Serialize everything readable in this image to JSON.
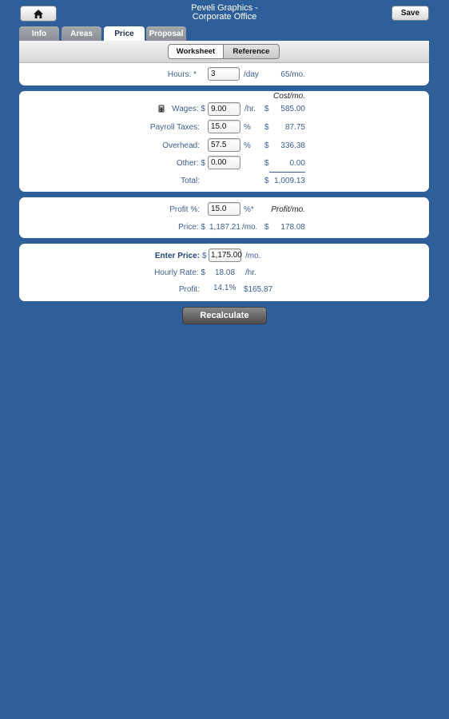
{
  "header": {
    "title_line1": "Peveli Graphics -",
    "title_line2": "Corporate Office",
    "save_label": "Save"
  },
  "tabs": [
    {
      "label": "Info"
    },
    {
      "label": "Areas"
    },
    {
      "label": "Price",
      "active": true
    },
    {
      "label": "Proposal"
    }
  ],
  "segments": {
    "worksheet": "Worksheet",
    "reference": "Reference"
  },
  "hours": {
    "label": "Hours: *",
    "value": "3",
    "unit": "/day",
    "monthly": "65/mo."
  },
  "costs": {
    "header": "Cost/mo.",
    "wages": {
      "label": "Wages: $",
      "value": "9.00",
      "unit": "/hr.",
      "currency": "$",
      "monthly": "585.00"
    },
    "payroll": {
      "label": "Payroll Taxes:",
      "value": "15.0",
      "unit": "%",
      "currency": "$",
      "monthly": "87.75"
    },
    "overhead": {
      "label": "Overhead:",
      "value": "57.5",
      "unit": "%",
      "currency": "$",
      "monthly": "336.38"
    },
    "other": {
      "label": "Other: $",
      "value": "0.00",
      "currency": "$",
      "monthly": "0.00"
    },
    "total": {
      "label": "Total:",
      "currency": "$",
      "monthly": "1,009.13"
    }
  },
  "profit": {
    "label": "Profit %:",
    "value": "15.0",
    "unit": "%*",
    "header": "Profit/mo.",
    "price_label": "Price: $",
    "price_value": "1,187.21",
    "price_unit": "/mo.",
    "currency": "$",
    "monthly": "178.08"
  },
  "enter": {
    "label": "Enter Price:",
    "currency": "$",
    "value": "1,175.00",
    "unit": "/mo.",
    "hourly_label": "Hourly Rate: $",
    "hourly_value": "18.08",
    "hourly_unit": "/hr.",
    "profit_label": "Profit:",
    "profit_pct": "14.1%",
    "profit_amount": "$165.87"
  },
  "recalculate_label": "Recalculate",
  "icons": {
    "home": "home-icon",
    "wages": "calculator-icon"
  }
}
